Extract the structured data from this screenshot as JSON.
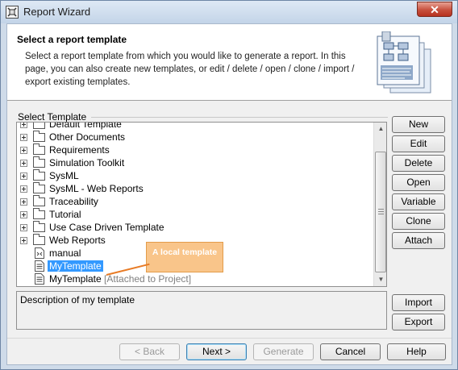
{
  "window": {
    "title": "Report Wizard",
    "close_label": "✕"
  },
  "header": {
    "title": "Select a report template",
    "description": "Select a report template from which you would like to generate a report. In this page, you can also create new templates, or edit / delete / open / clone / import / export existing templates."
  },
  "select_template": {
    "group_label": "Select Template",
    "items": [
      {
        "label": "Default Template",
        "type": "folder"
      },
      {
        "label": "Other Documents",
        "type": "folder"
      },
      {
        "label": "Requirements",
        "type": "folder"
      },
      {
        "label": "Simulation Toolkit",
        "type": "folder"
      },
      {
        "label": "SysML",
        "type": "folder"
      },
      {
        "label": "SysML - Web Reports",
        "type": "folder"
      },
      {
        "label": "Traceability",
        "type": "folder"
      },
      {
        "label": "Tutorial",
        "type": "folder"
      },
      {
        "label": "Use Case Driven Template",
        "type": "folder"
      },
      {
        "label": "Web Reports",
        "type": "folder"
      },
      {
        "label": "manual",
        "type": "xml-file"
      },
      {
        "label": "MyTemplate",
        "type": "template",
        "selected": true
      },
      {
        "label": "MyTemplate",
        "type": "template",
        "note": "[Attached to Project]"
      }
    ]
  },
  "callout": {
    "text": "A local template",
    "color": "#f9c58a"
  },
  "description_box": {
    "text": "Description of my template"
  },
  "side_buttons": {
    "new": "New",
    "edit": "Edit",
    "delete": "Delete",
    "open": "Open",
    "variable": "Variable",
    "clone": "Clone",
    "attach": "Attach",
    "import": "Import",
    "export": "Export"
  },
  "footer_buttons": {
    "back": "< Back",
    "next": "Next >",
    "generate": "Generate",
    "cancel": "Cancel",
    "help": "Help"
  },
  "colors": {
    "selection": "#3399ff",
    "frame": "#cfdbe9",
    "close_button": "#c7503d"
  }
}
